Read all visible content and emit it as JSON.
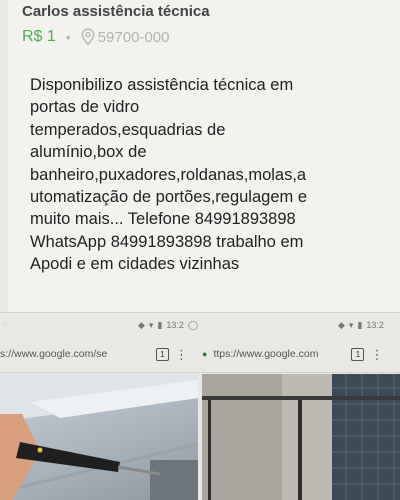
{
  "listing": {
    "title": "Carlos assistência técnica",
    "price": "R$ 1",
    "separator": "•",
    "cep": "59700-000",
    "description_lines": [
      "Disponibilizo assistência técnica em",
      "portas de vidro",
      "temperados,esquadrias de",
      "alumínio,box de",
      "banheiro,puxadores,roldanas,molas,a",
      "utomatização de portões,regulagem e",
      "muito mais... Telefone 84991893898",
      "WhatsApp 84991893898 trabalho em",
      "Apodi e em cidades vizinhas"
    ]
  },
  "status_bars": {
    "left": {
      "time": "13:2"
    },
    "right": {
      "time": "13:2"
    }
  },
  "browser_left": {
    "url": "s://www.google.com/se",
    "tab_count": "1"
  },
  "browser_right": {
    "url": "ttps://www.google.com",
    "tab_count": "1"
  },
  "icons": {
    "location": "location-pin-icon",
    "wifi": "wifi-icon",
    "signal": "signal-icon",
    "battery": "battery-icon",
    "whatsapp": "whatsapp-icon",
    "lock": "lock-icon",
    "tabs": "tab-switcher-icon",
    "menu": "overflow-menu-icon"
  },
  "colors": {
    "price": "#4caf50",
    "lock": "#2e7d32"
  }
}
